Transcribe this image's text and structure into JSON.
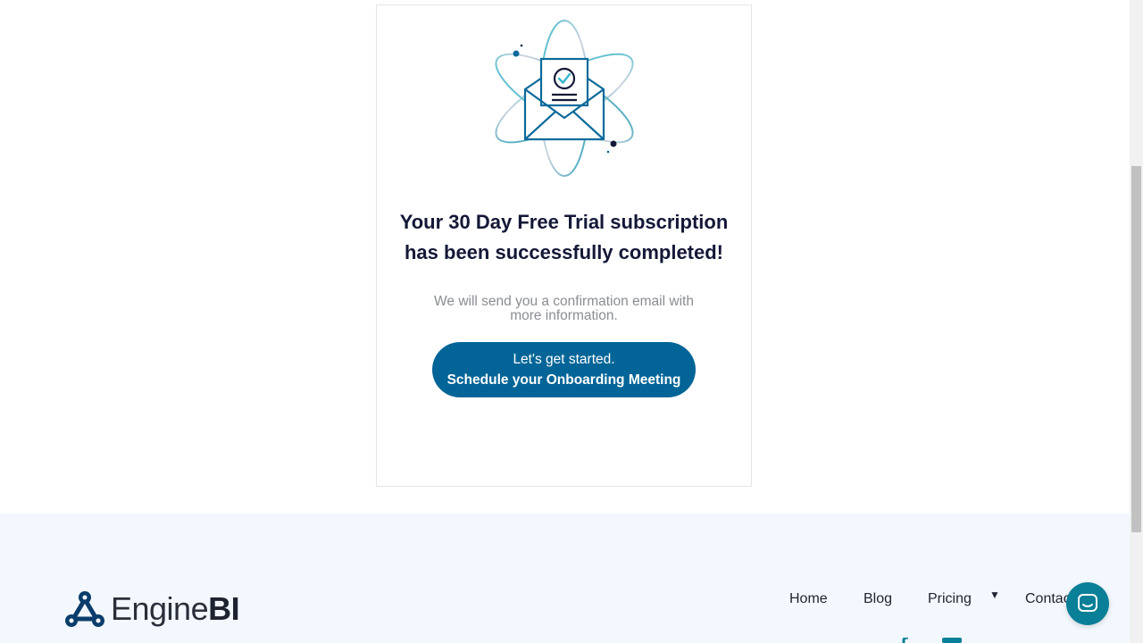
{
  "card": {
    "headline": [
      "Your 30 Day Free Trial subscription",
      "has been successfully completed!"
    ],
    "subtext": [
      "We will send you a confirmation email with",
      "more information."
    ],
    "cta": {
      "line1": "Let's get started.",
      "line2": "Schedule your Onboarding Meeting"
    },
    "illustration_icon": "envelope-certificate-atom-icon"
  },
  "footer": {
    "logo": {
      "regular": "Engine",
      "bold": "BI"
    },
    "nav": {
      "home": "Home",
      "blog": "Blog",
      "pricing": "Pricing",
      "contact": "Contact"
    }
  },
  "chat": {
    "icon": "chat-bubble-icon"
  },
  "colors": {
    "primary": "#036597",
    "headline": "#141837",
    "subtext": "#8a8d93",
    "footer_bg": "#f2f8fd",
    "chat": "#0a7f98"
  }
}
